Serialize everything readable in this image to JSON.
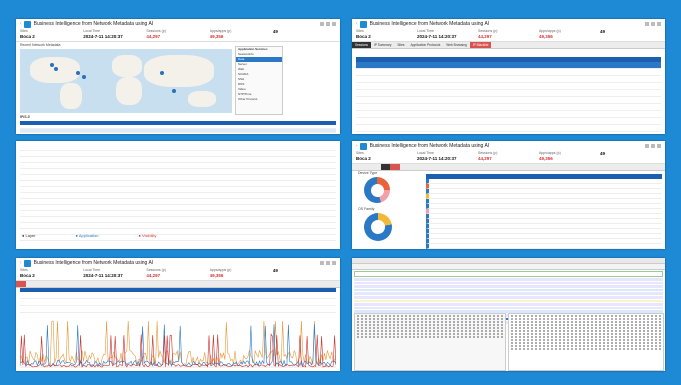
{
  "app": {
    "title": "Business Intelligence from Network Metadata using AI"
  },
  "stats": {
    "sites_label": "Sites",
    "sites_value": "Boca 2",
    "local_time_label": "Local Time",
    "local_time_value": "2024-7-11 14:20:37",
    "sessions_label": "Sessions (p)",
    "sessions_value": "44,297",
    "apps_label": "Apps/apps (p)",
    "apps_value": "49,356",
    "extra_value": "49"
  },
  "panels": {
    "map": {
      "caption": "Recent Network Metadata",
      "legend_title": "Application Services",
      "legend": [
        "SessionInfo",
        "Data",
        "Server",
        "Web",
        "SCADA",
        "SSH",
        "DNS",
        "Video",
        "NTP/Time",
        "Other Protocol"
      ],
      "selected_index": 2,
      "table_caption": "IP/S-0"
    },
    "sessions": {
      "tabs": [
        "Sessions",
        "IP Summary",
        "Sites",
        "Application Protocols",
        "Web Browsing",
        "IP Blacklist"
      ]
    },
    "list": {
      "footer_items": [
        "Layer",
        "Application",
        "Visibility"
      ]
    },
    "donuts": {
      "caption1": "Device Type",
      "caption2": "OS Family"
    }
  },
  "colors": {
    "background": "#1e8ad6",
    "accent": "#d9534f",
    "chart_orange": "#e8983a",
    "chart_blue": "#2b78c6",
    "chart_red": "#c9302c"
  }
}
